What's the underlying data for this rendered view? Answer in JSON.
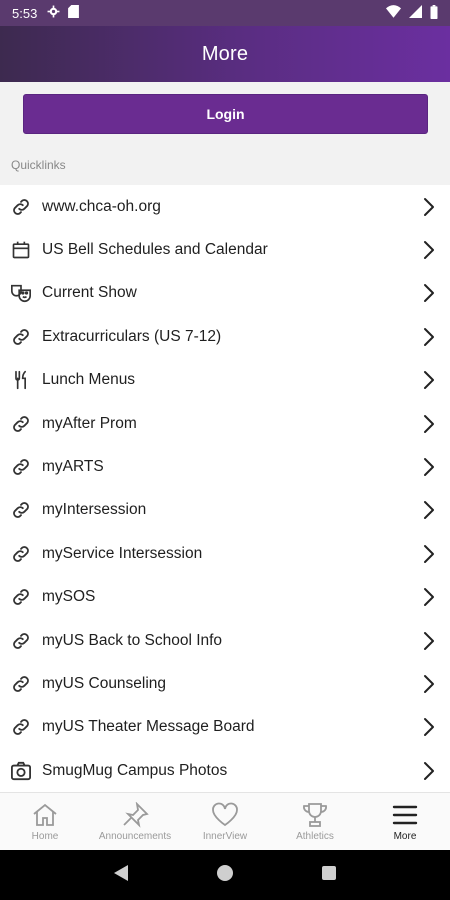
{
  "status": {
    "time": "5:53"
  },
  "appbar": {
    "title": "More"
  },
  "login": {
    "label": "Login"
  },
  "quicklinks": {
    "section_label": "Quicklinks",
    "items": [
      {
        "label": "www.chca-oh.org",
        "icon": "link-icon"
      },
      {
        "label": "US Bell Schedules and Calendar",
        "icon": "calendar-icon"
      },
      {
        "label": "Current Show",
        "icon": "theater-masks-icon"
      },
      {
        "label": "Extracurriculars (US 7-12)",
        "icon": "link-icon"
      },
      {
        "label": "Lunch Menus",
        "icon": "fork-knife-icon"
      },
      {
        "label": "myAfter Prom",
        "icon": "link-icon"
      },
      {
        "label": "myARTS",
        "icon": "link-icon"
      },
      {
        "label": "myIntersession",
        "icon": "link-icon"
      },
      {
        "label": "myService Intersession",
        "icon": "link-icon"
      },
      {
        "label": "mySOS",
        "icon": "link-icon"
      },
      {
        "label": "myUS Back to School Info",
        "icon": "link-icon"
      },
      {
        "label": "myUS Counseling",
        "icon": "link-icon"
      },
      {
        "label": "myUS Theater Message Board",
        "icon": "link-icon"
      },
      {
        "label": "SmugMug Campus Photos",
        "icon": "camera-icon"
      }
    ]
  },
  "bottom_nav": {
    "tabs": [
      {
        "label": "Home",
        "icon": "home-icon",
        "active": false
      },
      {
        "label": "Announcements",
        "icon": "pin-icon",
        "active": false
      },
      {
        "label": "InnerView",
        "icon": "heart-icon",
        "active": false
      },
      {
        "label": "Athletics",
        "icon": "trophy-icon",
        "active": false
      },
      {
        "label": "More",
        "icon": "menu-icon",
        "active": true
      }
    ]
  },
  "colors": {
    "appbar_start": "#3d2a4f",
    "appbar_end": "#6b2fa0",
    "login_button": "#6a2c91"
  }
}
